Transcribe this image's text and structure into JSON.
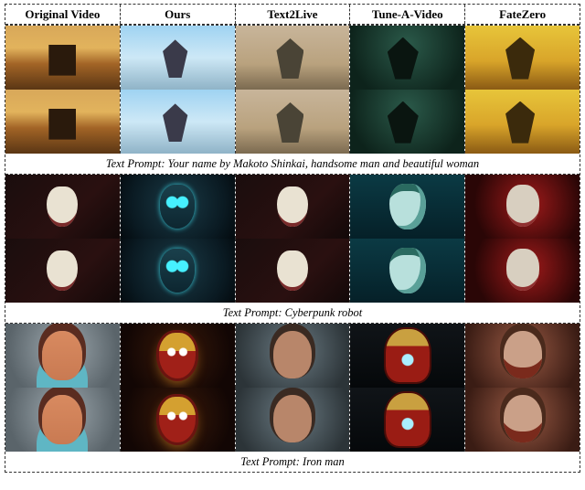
{
  "headers": [
    "Original Video",
    "Ours",
    "Text2Live",
    "Tune-A-Video",
    "FateZero"
  ],
  "blocks": [
    {
      "caption": "Text Prompt: Your name by Makoto Shinkai, handsome man and beautiful woman",
      "rows": 2,
      "styles": [
        "t-sunset",
        "t-anime",
        "t-muted",
        "t-darkg",
        "t-yellow"
      ]
    },
    {
      "caption": "Text Prompt: Cyberpunk robot",
      "rows": 2,
      "styles": [
        "g-dark",
        "g-cyber",
        "g-dark",
        "g-teal",
        "g-red"
      ]
    },
    {
      "caption": "Text Prompt: Iron man",
      "rows": 2,
      "styles": [
        "i-orig",
        "i-iron",
        "i-face",
        "i-suit",
        "i-tint"
      ]
    }
  ]
}
